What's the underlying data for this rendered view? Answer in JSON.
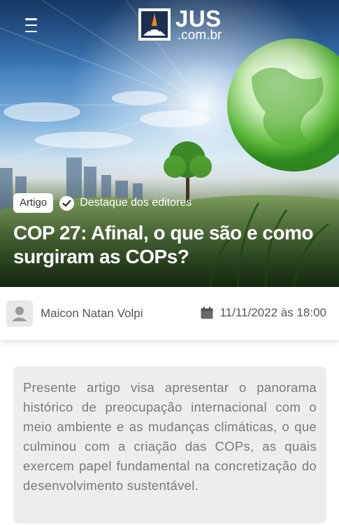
{
  "header": {
    "menu_icon": "hamburger-menu-icon",
    "logo_primary": "JUS",
    "logo_secondary": ".com.br"
  },
  "article": {
    "category_tag": "Artigo",
    "feature_badge": "Destaque dos editores",
    "title": "COP 27: Afinal, o que são e como surgiram as COPs?",
    "author": "Maicon Natan Volpi",
    "date": "11/11/2022 às 18:00",
    "abstract": "Presente artigo visa apresentar o panorama histórico de preocupação internacional com o meio ambiente e as mudanças climáticas, o que culminou com a criação das COPs, as quais exercem papel fundamental na concretização do desenvolvimento sustentável."
  },
  "colors": {
    "logo_orange": "#f0871e",
    "text_gray": "#555555",
    "abstract_bg": "#ededed"
  }
}
